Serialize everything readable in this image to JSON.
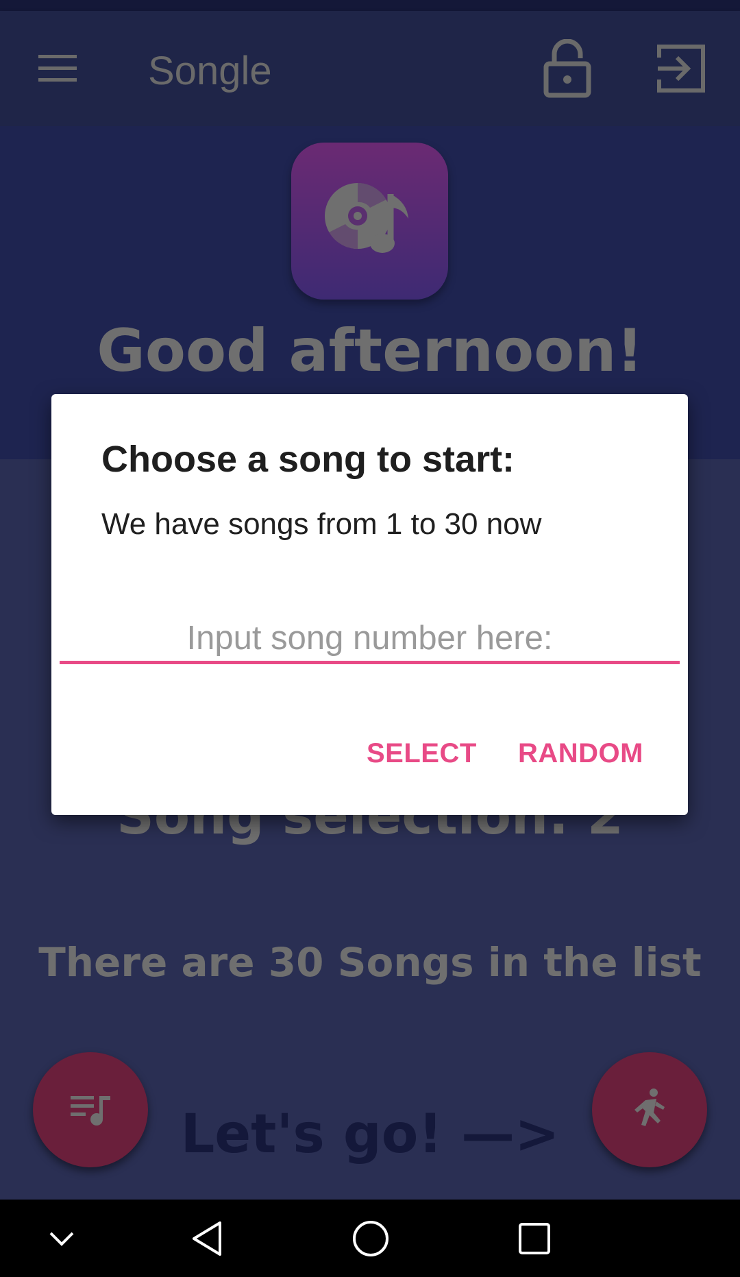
{
  "app_bar": {
    "title": "Songle",
    "icons": [
      "menu-icon",
      "lock-open-icon",
      "exit-icon"
    ]
  },
  "main": {
    "greeting": "Good afternoon!",
    "song_selection": "Song selection: 2",
    "song_count": "There are 30 Songs in the list",
    "lets_go": "Let's go! —>"
  },
  "fabs": {
    "left_icon": "playlist-music-icon",
    "right_icon": "run-icon"
  },
  "dialog": {
    "title": "Choose a song to start:",
    "message": "We have songs from 1 to 30 now",
    "input_placeholder": "Input song number here:",
    "input_value": "",
    "select_label": "SELECT",
    "random_label": "RANDOM"
  },
  "nav_bar": {
    "icons": [
      "chevron-down-icon",
      "back-icon",
      "home-icon",
      "recents-icon"
    ]
  },
  "colors": {
    "accent": "#e84a86",
    "app_bar": "#1f2548",
    "background": "#2a2f53",
    "fab": "#6a1f3b"
  }
}
